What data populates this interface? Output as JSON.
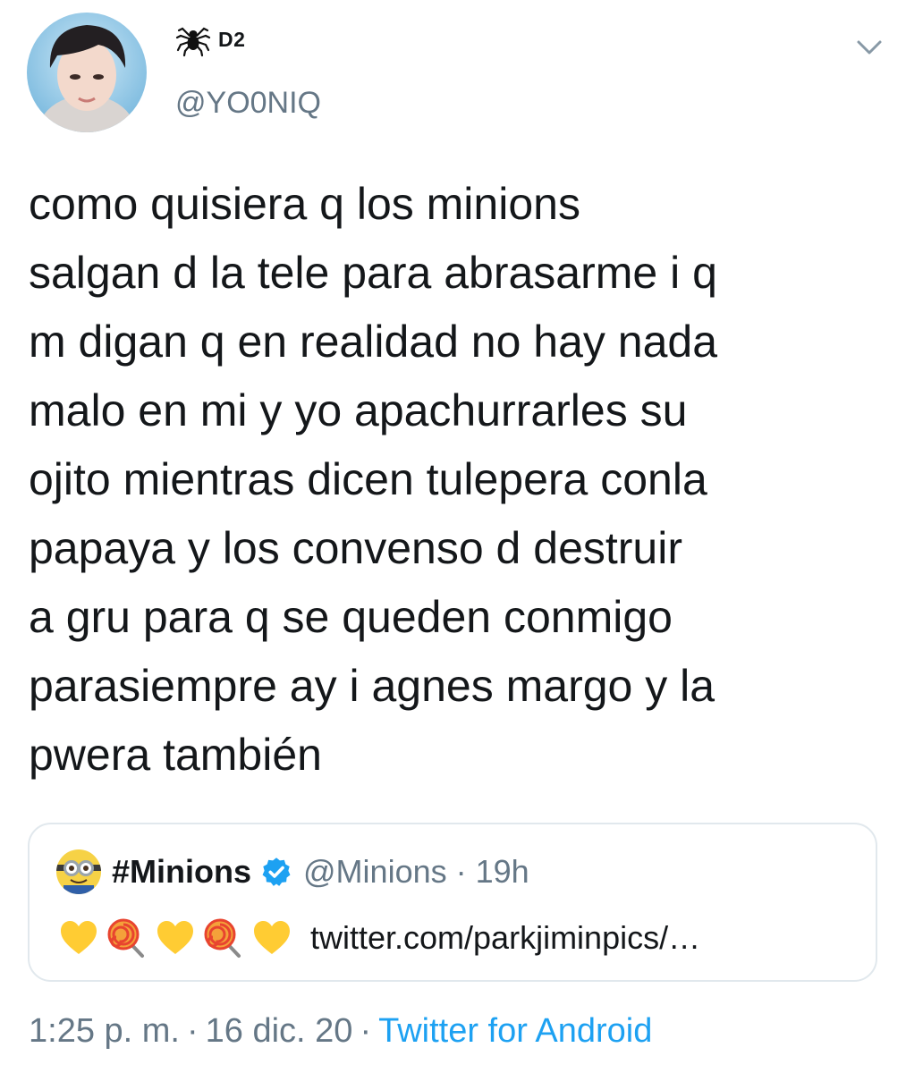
{
  "author": {
    "display_name": "D2",
    "name_icon": "spider-icon",
    "handle": "@YO0NIQ"
  },
  "tweet": {
    "text": "como quisiera q los minions\nsalgan d la tele para abrasarme i q\nm digan q en realidad no hay nada\nmalo en mi y yo apachurrarles su\nojito mientras dicen tulepera conla\npapaya y los convenso d destruir\na gru para q se queden conmigo\nparasiempre ay i agnes margo y la\npwera también"
  },
  "quoted_tweet": {
    "name": "#Minions",
    "verified_icon": "verified-badge-icon",
    "handle": "@Minions",
    "separator": "·",
    "time": "19h",
    "emojis": [
      "yellow-heart-icon",
      "lollipop-icon",
      "yellow-heart-icon",
      "lollipop-icon",
      "yellow-heart-icon"
    ],
    "link": "twitter.com/parkjiminpics/…"
  },
  "meta": {
    "time": "1:25 p. m.",
    "separator": "·",
    "date": "16 dic. 20",
    "source": "Twitter for Android"
  },
  "colors": {
    "text": "#14171a",
    "secondary": "#657786",
    "link": "#1da1f2",
    "border": "#e1e8ed",
    "heart": "#ffcc33"
  }
}
